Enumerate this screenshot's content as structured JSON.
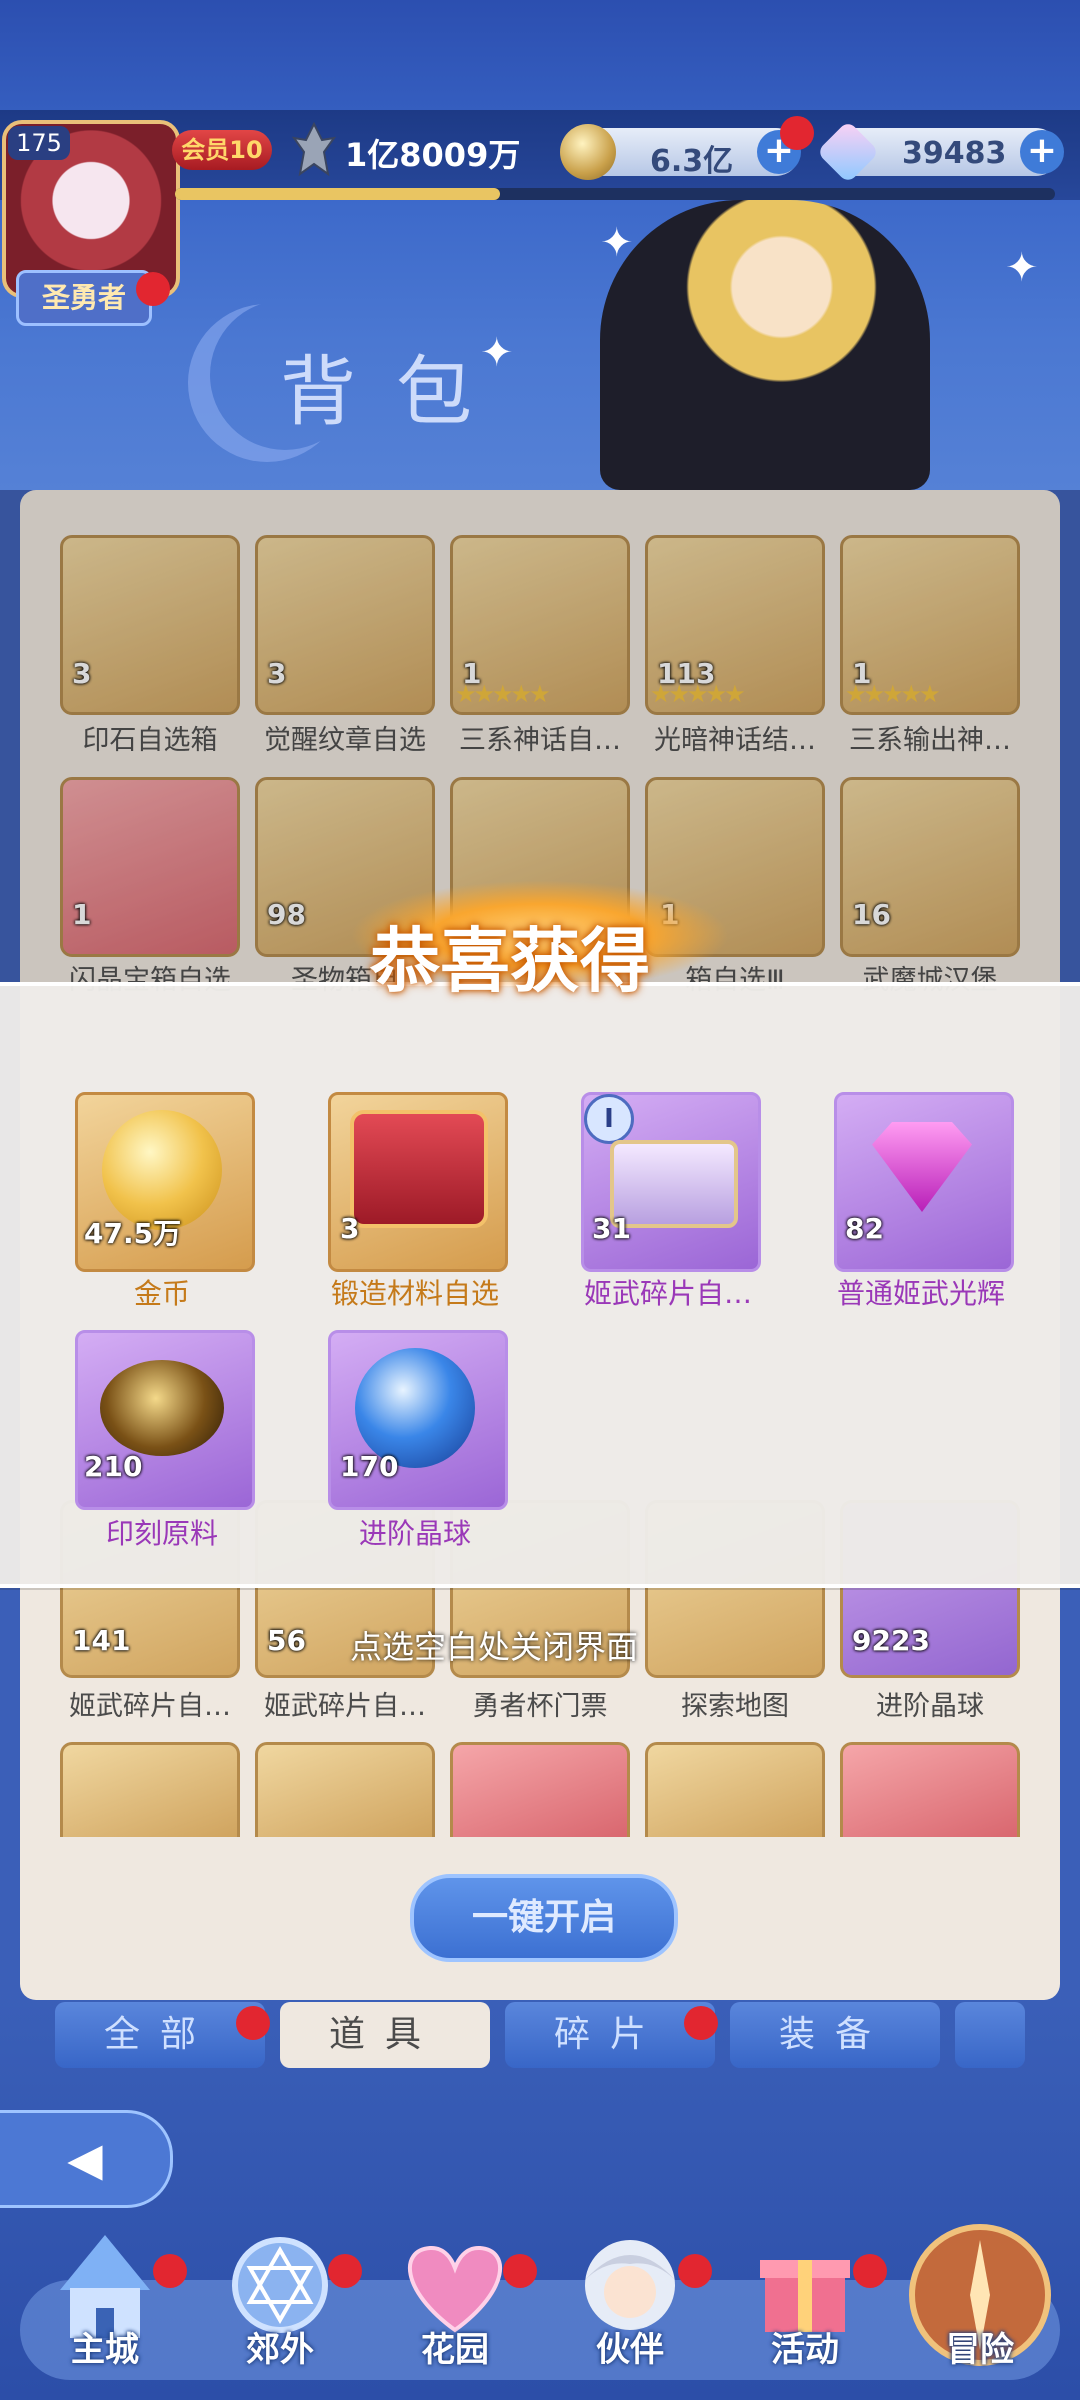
{
  "header": {
    "level": "175",
    "title_badge": "圣勇者",
    "vip": "会员10",
    "power": "1亿8009万",
    "gold": "6.3亿",
    "diamonds": "39483",
    "page_title": "背包"
  },
  "inventory": {
    "row1": [
      {
        "count": "3",
        "label": "印石自选箱"
      },
      {
        "count": "3",
        "label": "觉醒纹章自选"
      },
      {
        "count": "1",
        "label": "三系神话自…"
      },
      {
        "count": "113",
        "label": "光暗神话结…"
      },
      {
        "count": "1",
        "label": "三系输出神…"
      }
    ],
    "row2": [
      {
        "count": "1",
        "label": "闪晶宝箱自选"
      },
      {
        "count": "98",
        "label": "圣物箱自"
      },
      {
        "count": "",
        "label": ""
      },
      {
        "count": "1",
        "label": "箱自选Ⅲ"
      },
      {
        "count": "16",
        "label": "武魔城汉堡"
      }
    ],
    "row5": [
      {
        "count": "141",
        "label": "姬武碎片自…"
      },
      {
        "count": "56",
        "label": "姬武碎片自…"
      },
      {
        "count": "",
        "label": "勇者杯门票"
      },
      {
        "count": "",
        "label": "探索地图"
      },
      {
        "count": "9223",
        "label": "进阶晶球"
      }
    ],
    "close_hint": "点选空白处关闭界面",
    "one_key_open": "一键开启"
  },
  "tabs": [
    "全部",
    "道具",
    "碎片",
    "装备"
  ],
  "reward_modal": {
    "title": "恭喜获得",
    "items": [
      {
        "count": "47.5万",
        "label": "金币"
      },
      {
        "count": "3",
        "label": "锻造材料自选"
      },
      {
        "count": "31",
        "label": "姬武碎片自…"
      },
      {
        "count": "82",
        "label": "普通姬武光辉"
      },
      {
        "count": "210",
        "label": "印刻原料"
      },
      {
        "count": "170",
        "label": "进阶晶球"
      }
    ]
  },
  "bottom_nav": [
    "主城",
    "郊外",
    "花园",
    "伙伴",
    "活动",
    "冒险"
  ],
  "colors": {
    "accent_blue": "#3c70d2",
    "gold_label": "#c57a1a",
    "purple_label": "#9a38b8",
    "red_dot": "#e22630"
  }
}
